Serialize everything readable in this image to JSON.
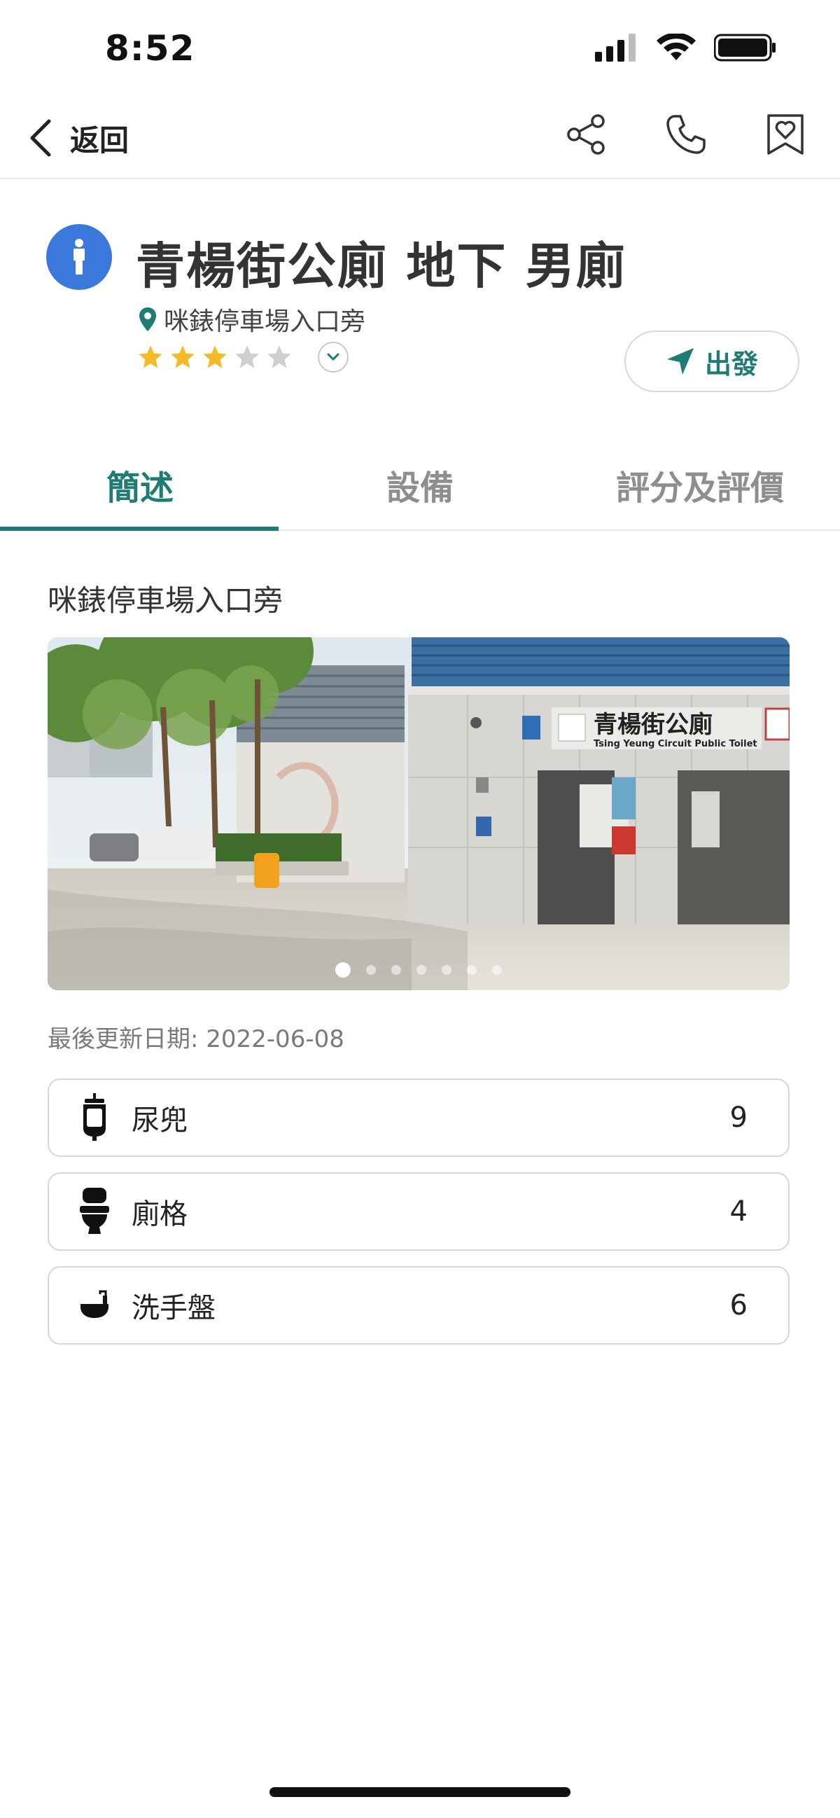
{
  "status_bar": {
    "time": "8:52"
  },
  "nav": {
    "back_label": "返回",
    "icons": [
      "share-icon",
      "phone-icon",
      "bookmark-heart-icon"
    ]
  },
  "place": {
    "title": "青楊街公廁 地下 男廁",
    "location": "咪錶停車場入口旁",
    "rating": 3,
    "rating_max": 5,
    "go_label": "出發",
    "type_icon": "male-person-icon",
    "accent_color": "#1f7c74",
    "badge_color": "#3a78dc",
    "star_color": "#f6b928"
  },
  "tabs": [
    {
      "label": "簡述",
      "active": true
    },
    {
      "label": "設備",
      "active": false
    },
    {
      "label": "評分及評價",
      "active": false
    }
  ],
  "overview": {
    "section_title": "咪錶停車場入口旁",
    "photo": {
      "sign_chinese": "青楊街公廁",
      "sign_english": "Tsing Yeung Circuit Public Toilet",
      "page_count": 7,
      "current_page": 1
    },
    "last_updated": "最後更新日期: 2022-06-08"
  },
  "facilities": [
    {
      "label": "尿兜",
      "count": "9",
      "icon": "urinal-icon"
    },
    {
      "label": "廁格",
      "count": "4",
      "icon": "toilet-icon"
    },
    {
      "label": "洗手盤",
      "count": "6",
      "icon": "sink-icon"
    }
  ]
}
